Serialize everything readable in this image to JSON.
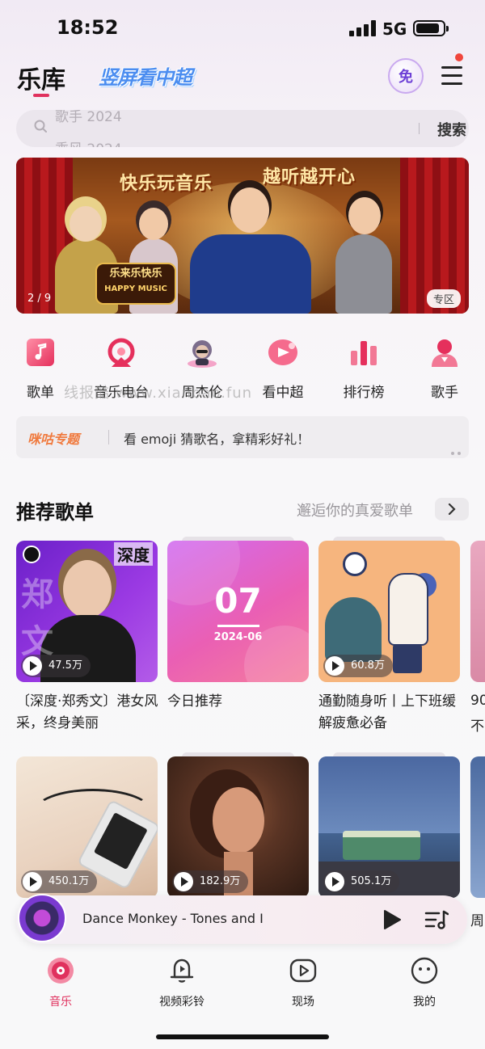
{
  "status_bar": {
    "time": "18:52",
    "network": "5G"
  },
  "header": {
    "title": "乐库",
    "promo_logo": "竖屏看中超",
    "vip_badge": "免"
  },
  "search": {
    "placeholder_1": "歌手 2024",
    "placeholder_2": "乘风 2024",
    "button": "搜索"
  },
  "banner": {
    "slogan_1": "快乐玩音乐",
    "slogan_2": "越听越开心",
    "show_logo": "乐来乐快乐",
    "show_logo_sub": "HAPPY MUSIC",
    "page_indicator": "2 / 9",
    "tag": "专区"
  },
  "quick_nav": {
    "items": [
      {
        "label": "歌单",
        "icon": "playlist-icon"
      },
      {
        "label": "音乐电台",
        "icon": "radio-icon"
      },
      {
        "label": "周杰伦",
        "icon": "jay-chou-avatar-icon"
      },
      {
        "label": "看中超",
        "icon": "soccer-icon"
      },
      {
        "label": "排行榜",
        "icon": "chart-icon"
      },
      {
        "label": "歌手",
        "icon": "singer-icon"
      }
    ],
    "watermark": "线报酷 www.xianbao.fun"
  },
  "topic": {
    "tag": "咪咕专题",
    "text": "看 emoji 猜歌名，拿精彩好礼！"
  },
  "recommend": {
    "title": "推荐歌单",
    "subtitle": "邂逅你的真爱歌单",
    "cards": [
      {
        "title": "〔深度·郑秀文〕港女风采，终身美丽",
        "plays": "47.5万",
        "cover_tag": "深度",
        "cover_text": "郑 文"
      },
      {
        "title": "今日推荐",
        "plays": "",
        "cover_day": "07",
        "cover_date": "2024-06"
      },
      {
        "title": "通勤随身听丨上下班缓解疲惫必备",
        "plays": "60.8万"
      },
      {
        "title": "",
        "plays": "450.1万"
      },
      {
        "title": "",
        "plays": "182.9万"
      },
      {
        "title": "",
        "plays": "505.1万"
      }
    ],
    "peek_text_1": "90",
    "peek_text_2": "不",
    "peek_text_3": "周"
  },
  "mini_player": {
    "title": "Dance Monkey - Tones and I"
  },
  "tab_bar": {
    "items": [
      {
        "label": "音乐",
        "active": true
      },
      {
        "label": "视频彩铃",
        "active": false
      },
      {
        "label": "现场",
        "active": false
      },
      {
        "label": "我的",
        "active": false
      }
    ]
  },
  "colors": {
    "accent": "#e0315e",
    "topic_tag": "#f07a3e",
    "vip": "#6d3fd6"
  }
}
